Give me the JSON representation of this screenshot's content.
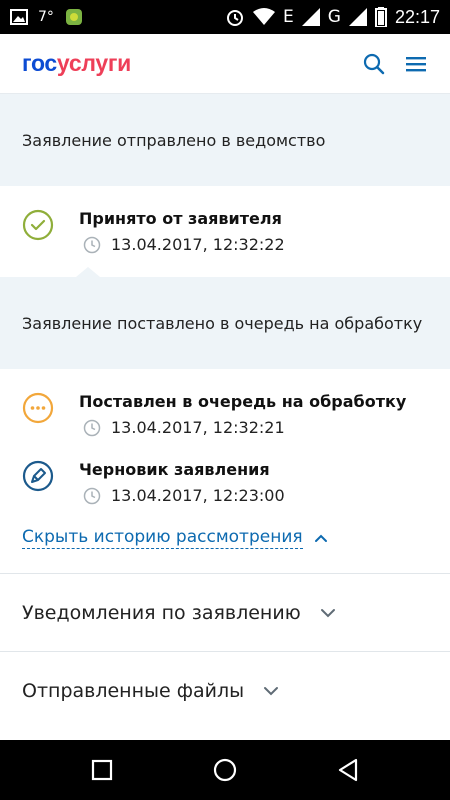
{
  "status_bar": {
    "temperature": "7°",
    "network_label": "E",
    "network_label2": "G",
    "time": "22:17"
  },
  "header": {
    "logo_part1": "гос",
    "logo_part2": "услуги"
  },
  "history": {
    "sent_banner": "Заявление отправлено в ведомство",
    "queued_banner": "Заявление поставлено в очередь на обработку",
    "items": [
      {
        "title": "Принято от заявителя",
        "date": "13.04.2017, 12:32:22"
      },
      {
        "title": "Поставлен в очередь на обработку",
        "date": "13.04.2017, 12:32:21"
      },
      {
        "title": "Черновик заявления",
        "date": "13.04.2017, 12:23:00"
      }
    ],
    "hide_link": "Скрыть историю рассмотрения"
  },
  "sections": {
    "notifications": "Уведомления по заявлению",
    "sent_files": "Отправленные файлы"
  },
  "colors": {
    "accepted": "#8fae3a",
    "queued": "#f2a73b",
    "draft": "#1c5a8c",
    "link": "#0d6ab0",
    "logo_blue": "#0d4cd3",
    "logo_red": "#ee3f58"
  }
}
